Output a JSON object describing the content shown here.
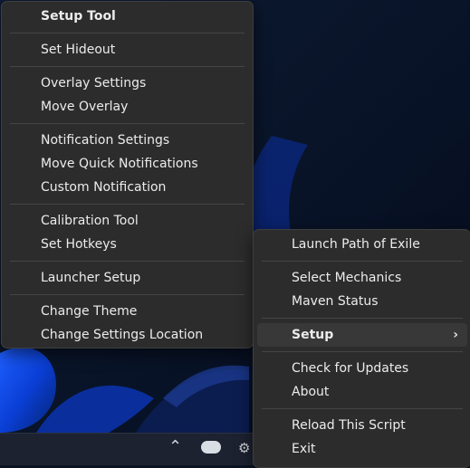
{
  "colors": {
    "menu_bg": "#2c2c2c",
    "menu_text": "#ececec",
    "highlight": "#383838",
    "separator": "#454545"
  },
  "context_menu": {
    "items": [
      "Setup Tool",
      "Set Hideout",
      "Overlay Settings",
      "Move Overlay",
      "Notification Settings",
      "Move Quick Notifications",
      "Custom Notification",
      "Calibration Tool",
      "Set Hotkeys",
      "Launcher Setup",
      "Change Theme",
      "Change Settings Location"
    ]
  },
  "tray_menu": {
    "items": [
      "Launch Path of Exile",
      "Select Mechanics",
      "Maven Status",
      "Setup",
      "Check for Updates",
      "About",
      "Reload This Script",
      "Exit"
    ]
  },
  "taskbar": {
    "icons": [
      "chevron-up-icon",
      "cloud-icon",
      "gear-icon"
    ]
  }
}
